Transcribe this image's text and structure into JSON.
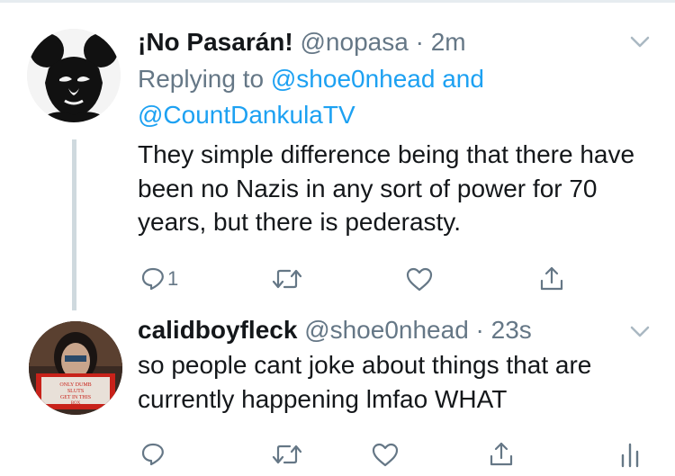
{
  "tweets": [
    {
      "display_name": "¡No Pasarán!",
      "handle": "@nopasa",
      "separator": "·",
      "time": "2m",
      "reply_prefix": "Replying to",
      "reply_mention_1": "@shoe0nhead",
      "reply_conjunction": "and",
      "reply_mention_2": "@CountDankulaTV",
      "text": "They simple difference being that there have been no Nazis in any sort of power for 70 years, but there is pederasty.",
      "reply_count": "1",
      "avatar_icon": "che-guevara-mouse-ears-avatar",
      "actions": [
        "reply-icon",
        "retweet-icon",
        "like-icon",
        "share-icon"
      ]
    },
    {
      "display_name": "calidboyfleck",
      "handle": "@shoe0nhead",
      "separator": "·",
      "time": "23s",
      "text": "so people cant joke about things that are currently happening lmfao WHAT",
      "avatar_sign_text": "ONLY DUMB SLUTS GET IN THIS BOX",
      "avatar_icon": "person-with-sign-avatar",
      "actions": [
        "reply-icon",
        "retweet-icon",
        "like-icon",
        "share-icon",
        "analytics-icon"
      ]
    }
  ],
  "colors": {
    "text_primary": "#14171a",
    "text_secondary": "#657786",
    "link": "#1da1f2",
    "icon": "#657786",
    "divider": "#e6ecf0",
    "thread_line": "#cfd9de"
  }
}
